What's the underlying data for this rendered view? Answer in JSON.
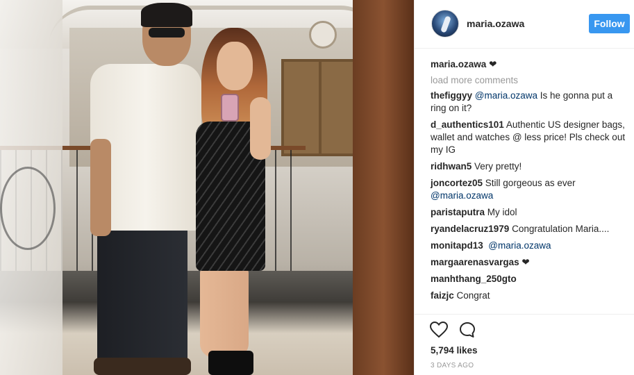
{
  "post": {
    "image_alt": "",
    "username": "maria.ozawa",
    "follow_label": "Follow",
    "caption_user": "maria.ozawa",
    "caption_text": "❤",
    "load_more_label": "load more comments",
    "comments": [
      {
        "user": "thefiggyy",
        "mention": "@maria.ozawa",
        "text": " Is he gonna put a ring on it? ⁠⁠"
      },
      {
        "user": "d_authentics101",
        "mention": "",
        "text": "Authentic US designer bags, wallet and watches @ less price! Pls check out my IG ⁠"
      },
      {
        "user": "ridhwan5",
        "mention": "",
        "text": "Very pretty!"
      },
      {
        "user": "joncortez05",
        "mention": "",
        "text": "Still gorgeous as ever ",
        "mention_after": "@maria.ozawa"
      },
      {
        "user": "paristaputra",
        "mention": "",
        "text": "My idol ⁠"
      },
      {
        "user": "ryandelacruz1979",
        "mention": "",
        "text": "Congratulation Maria...."
      },
      {
        "user": "monitapd13",
        "mention": "",
        "text": "⁠⁠⁠⁠⁠⁠ ",
        "mention_after": "@maria.ozawa"
      },
      {
        "user": "margaarenasvargas",
        "mention": "",
        "text": "❤"
      },
      {
        "user": "manhthang_250gto",
        "mention": "",
        "text": "⁠⁠⁠⁠⁠"
      },
      {
        "user": "faizjc",
        "mention": "",
        "text": "Congrat"
      }
    ],
    "likes": "5,794 likes",
    "timestamp": "3 DAYS AGO"
  },
  "colors": {
    "follow_button": "#3897f0",
    "mention": "#003569",
    "muted": "#999999"
  },
  "icons": [
    "heart-icon",
    "comment-icon"
  ]
}
